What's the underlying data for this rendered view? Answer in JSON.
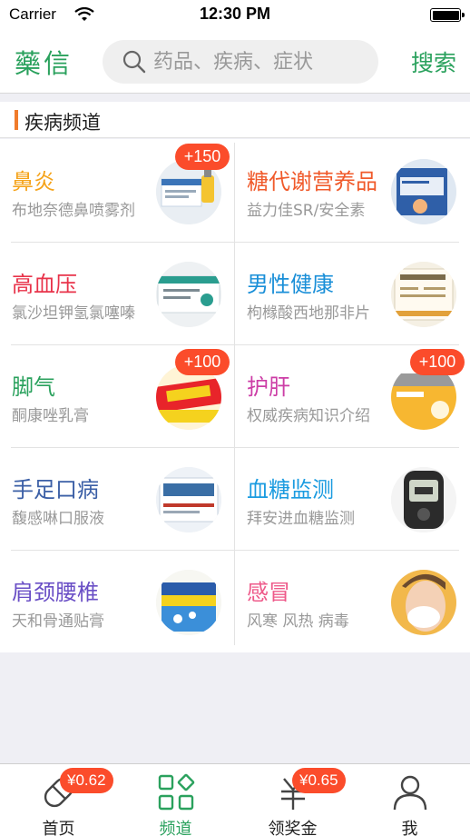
{
  "status_bar": {
    "carrier": "Carrier",
    "time": "12:30 PM"
  },
  "header": {
    "logo": "藥信",
    "search_placeholder": "药品、疾病、症状",
    "search_button": "搜索"
  },
  "section": {
    "title": "疾病频道"
  },
  "channels": [
    {
      "title": "鼻炎",
      "subtitle": "布地奈德鼻喷雾剂",
      "color": "#f5a31a",
      "badge": "+150",
      "image_icon": "nasal-spray-box"
    },
    {
      "title": "糖代谢营养品",
      "subtitle": "益力佳SR/安全素",
      "color": "#f05a2b",
      "badge": "",
      "image_icon": "nutrition-box"
    },
    {
      "title": "高血压",
      "subtitle": "氯沙坦钾氢氯噻嗪",
      "color": "#e8334a",
      "badge": "",
      "image_icon": "blood-pressure-medicine-box"
    },
    {
      "title": "男性健康",
      "subtitle": "枸橼酸西地那非片",
      "color": "#1a8fd8",
      "badge": "",
      "image_icon": "mens-health-medicine-box"
    },
    {
      "title": "脚气",
      "subtitle": "酮康唑乳膏",
      "color": "#2aa15d",
      "badge": "+100",
      "image_icon": "cream-box"
    },
    {
      "title": "护肝",
      "subtitle": "权威疾病知识介绍",
      "color": "#cc3da6",
      "badge": "+100",
      "image_icon": "liver-care-box"
    },
    {
      "title": "手足口病",
      "subtitle": "馥感啉口服液",
      "color": "#3b5fa6",
      "badge": "",
      "image_icon": "oral-liquid-box"
    },
    {
      "title": "血糖监测",
      "subtitle": "拜安进血糖监测",
      "color": "#1a9be0",
      "badge": "",
      "image_icon": "glucose-meter"
    },
    {
      "title": "肩颈腰椎",
      "subtitle": "天和骨通贴膏",
      "color": "#6a4fc6",
      "badge": "",
      "image_icon": "plaster-box"
    },
    {
      "title": "感冒",
      "subtitle": "风寒 风热 病毒",
      "color": "#ee5a8a",
      "badge": "",
      "image_icon": "cold-woman-tissue"
    }
  ],
  "tabbar": [
    {
      "label": "首页",
      "badge": "¥0.62",
      "icon": "pill-icon",
      "active": false
    },
    {
      "label": "频道",
      "badge": "",
      "icon": "grid-icon",
      "active": true
    },
    {
      "label": "领奖金",
      "badge": "¥0.65",
      "icon": "yuan-icon",
      "active": false
    },
    {
      "label": "我",
      "badge": "",
      "icon": "person-icon",
      "active": false
    }
  ],
  "colors": {
    "brand": "#2aa15d",
    "badge": "#fb4c2b",
    "section_accent": "#f07b2b"
  }
}
